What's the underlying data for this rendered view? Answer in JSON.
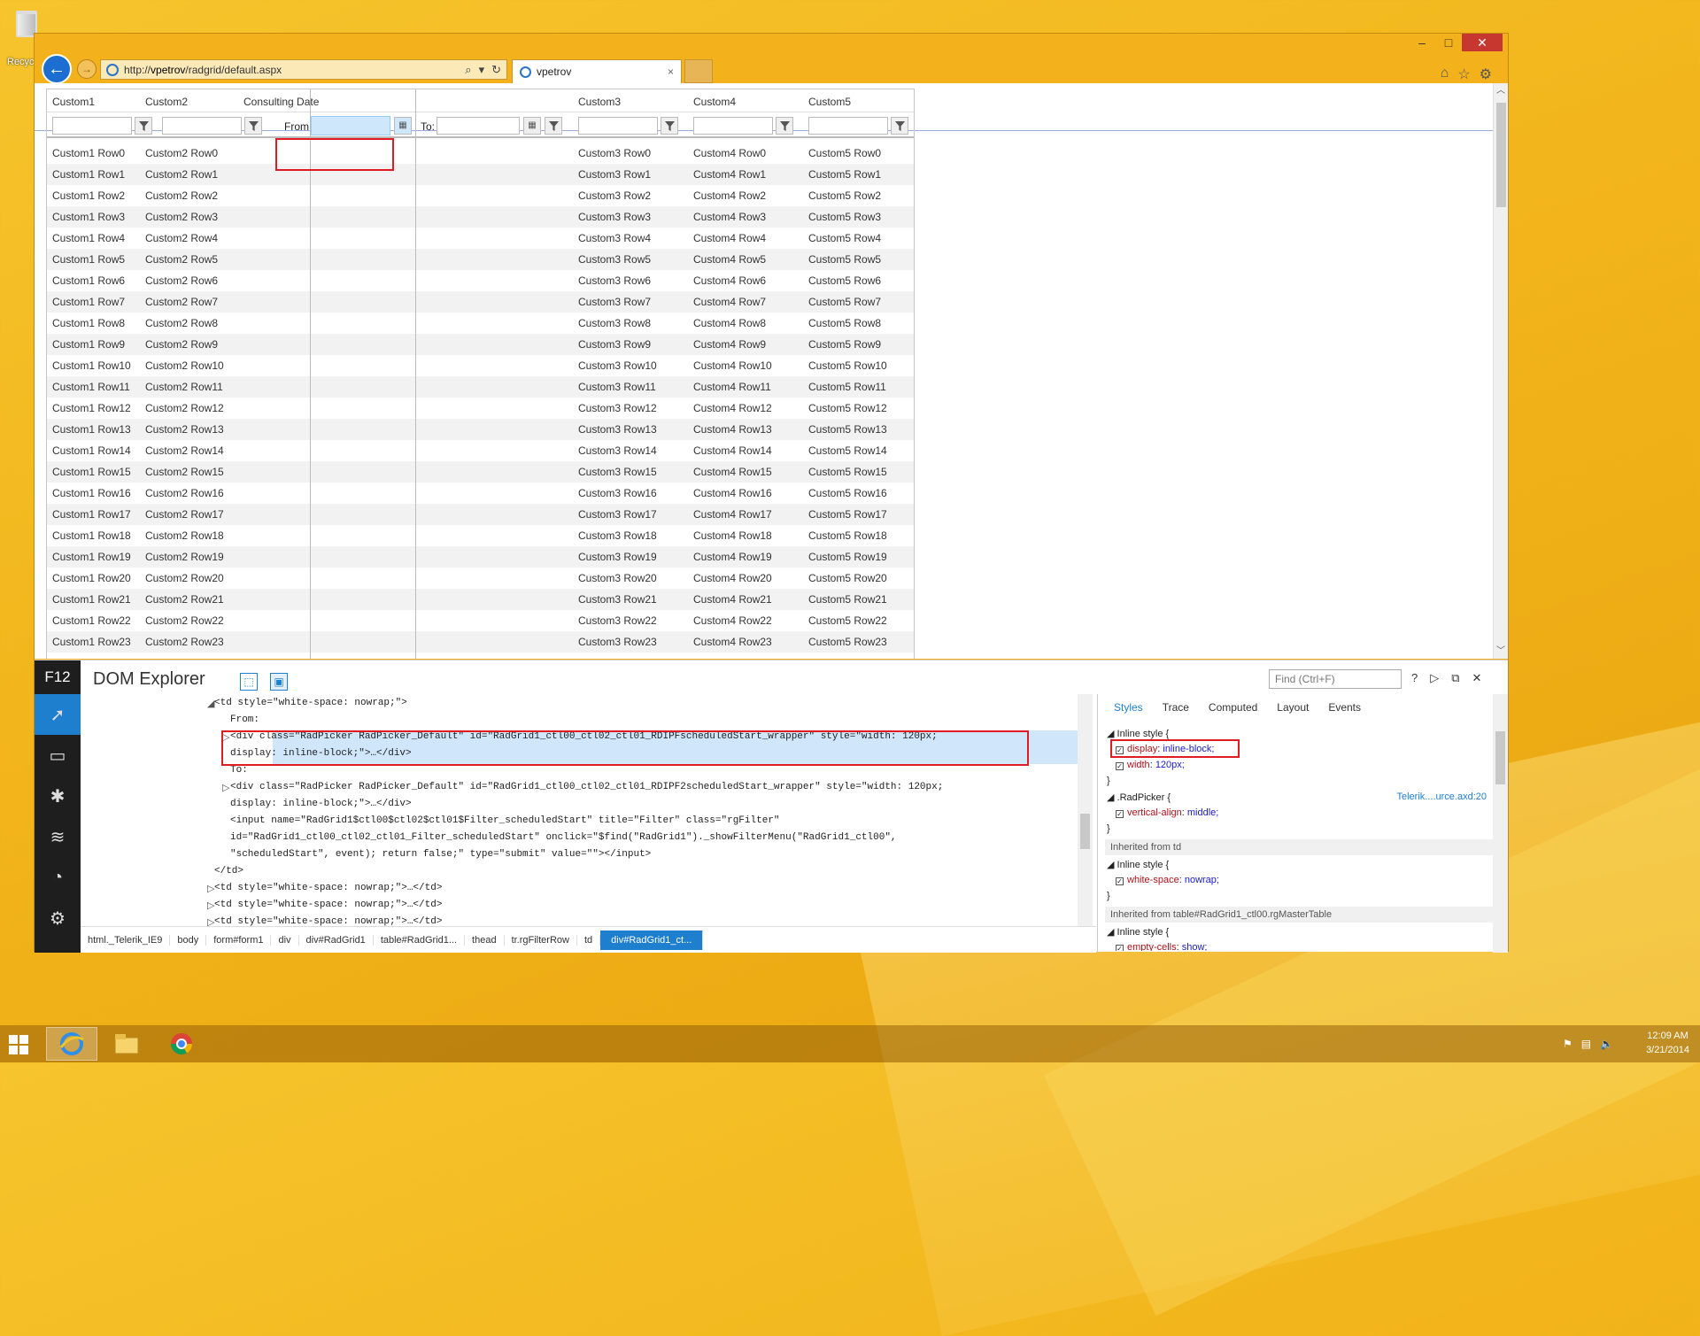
{
  "desktop": {
    "recycle_label": "Recyc"
  },
  "browser": {
    "url_prefix": "http://",
    "url_host": "vpetrov",
    "url_path": "/radgrid/default.aspx",
    "tab_title": "vpetrov",
    "tab_close": "×",
    "back_glyph": "←",
    "forward_glyph": "→",
    "min_glyph": "–",
    "max_glyph": "□",
    "close_glyph": "✕"
  },
  "grid": {
    "headers": [
      "Custom1",
      "Custom2",
      "Consulting Date",
      "Custom3",
      "Custom4",
      "Custom5"
    ],
    "filter_from": "From:",
    "filter_to": "To:",
    "columns": [
      "Custom1",
      "Custom2",
      "Custom3",
      "Custom4",
      "Custom5"
    ],
    "row_count": 24
  },
  "devtools": {
    "badge": "F12",
    "title": "DOM Explorer",
    "find_placeholder": "Find (Ctrl+F)",
    "help": "?",
    "dom_lines": [
      "<td style=\"white-space: nowrap;\">",
      "From:",
      "<div class=\"RadPicker RadPicker_Default\" id=\"RadGrid1_ctl00_ctl02_ctl01_RDIPFscheduledStart_wrapper\" style=\"width: 120px;",
      "display: inline-block;\">…</div>",
      "To:",
      "<div class=\"RadPicker RadPicker_Default\" id=\"RadGrid1_ctl00_ctl02_ctl01_RDIPF2scheduledStart_wrapper\" style=\"width: 120px;",
      "display: inline-block;\">…</div>",
      "<input name=\"RadGrid1$ctl00$ctl02$ctl01$Filter_scheduledStart\" title=\"Filter\" class=\"rgFilter\"",
      "id=\"RadGrid1_ctl00_ctl02_ctl01_Filter_scheduledStart\" onclick=\"$find(\"RadGrid1\")._showFilterMenu(\"RadGrid1_ctl00\",",
      "\"scheduledStart\", event); return false;\" type=\"submit\" value=\"\"></input>",
      "</td>",
      "<td style=\"white-space: nowrap;\">…</td>",
      "<td style=\"white-space: nowrap;\">…</td>",
      "<td style=\"white-space: nowrap;\">…</td>"
    ],
    "breadcrumbs": [
      "html._Telerik_IE9",
      "body",
      "form#form1",
      "div",
      "div#RadGrid1",
      "table#RadGrid1...",
      "thead",
      "tr.rgFilterRow",
      "td",
      "div#RadGrid1_ct..."
    ],
    "style_tabs": [
      "Styles",
      "Trace",
      "Computed",
      "Layout",
      "Events"
    ],
    "styles": {
      "inline_style": "Inline style  {",
      "display_prop": "display",
      "display_val": "inline-block;",
      "width_prop": "width",
      "width_val": "120px;",
      "close_brace": "}",
      "radpicker": ".RadPicker  {",
      "radpicker_source": "Telerik....urce.axd:20",
      "va_prop": "vertical-align",
      "va_val": "middle;",
      "inherited_td": "Inherited from td",
      "ws_prop": "white-space",
      "ws_val": "nowrap;",
      "inherited_table": "Inherited from table#RadGrid1_ctl00.rgMasterTable",
      "ec_prop": "empty-cells",
      "ec_val": "show;"
    }
  },
  "taskbar": {
    "time": "12:09 AM",
    "date": "3/21/2014"
  },
  "colors": {
    "accent": "#1f7fcf",
    "highlight": "#e11b22",
    "desktop": "#f2b51b"
  }
}
